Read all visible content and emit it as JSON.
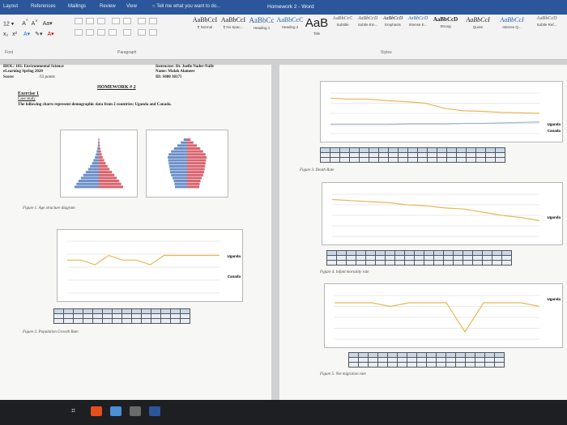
{
  "window": {
    "doc_title": "Homework 2 - Word",
    "tabs": [
      {
        "label": "Layout"
      },
      {
        "label": "References"
      },
      {
        "label": "Mailings"
      },
      {
        "label": "Review"
      },
      {
        "label": "View"
      },
      {
        "label": "Tell me what you want to do..."
      }
    ]
  },
  "ribbon": {
    "font_size": "12",
    "font_label": "Font",
    "paragraph_label": "Paragraph",
    "styles_label": "Styles",
    "styles": [
      {
        "sample": "AaBbCcI",
        "name": "¶ Normal"
      },
      {
        "sample": "AaBbCcI",
        "name": "¶ No Spac..."
      },
      {
        "sample": "AaBbCc",
        "name": "Heading 1"
      },
      {
        "sample": "AaBbCcC",
        "name": "Heading 2"
      },
      {
        "sample": "AaB",
        "name": "Title"
      },
      {
        "sample": "AaBbCcC",
        "name": "Subtitle"
      },
      {
        "sample": "AaBbCcD",
        "name": "Subtle Em..."
      },
      {
        "sample": "AaBbCcD",
        "name": "Emphasis"
      },
      {
        "sample": "AaBbCcD",
        "name": "Intense E..."
      },
      {
        "sample": "AaBbCcD",
        "name": "Strong"
      },
      {
        "sample": "AaBbCcI",
        "name": "Quote"
      },
      {
        "sample": "AaBbCcI",
        "name": "Intense Q..."
      },
      {
        "sample": "AaBbCcD",
        "name": "Subtle Ref..."
      }
    ]
  },
  "document": {
    "course": "BIOL/ 103: Environmental Science",
    "term": "eLearning Spring 2020",
    "score_label": "Score:",
    "score_value": "/15 points",
    "instructor": "Instructor: Dr. Joelle Nader-Nafir",
    "name": "Name: Malak Alameer",
    "id": "ID: S000 38175",
    "homework": "HOMEWORK # 2",
    "exercise": "Exercise 1",
    "case_study": "Case study",
    "intro": "The following charts represent demographic data from 2 countries: Uganda and Canada.",
    "figure1_caption": "Figure 1. Age structure diagram",
    "figure2_caption": "Figure 2. Population Growth Rate",
    "figure3_caption": "Figure 3. Death Rate",
    "figure4_caption": "Figure 4. Infant mortality rate",
    "figure5_caption": "Figure 5. Net migration rate",
    "legend_uganda": "Uganda",
    "legend_canada": "Canada"
  },
  "colors": {
    "word_blue": "#2b579a",
    "series_uganda": "#e8b75a",
    "series_canada": "#9cb4d6",
    "pyramid_male": "#6b8fc7",
    "pyramid_female": "#d9646e",
    "grid": "#d3d3d3"
  },
  "charts_series": {
    "growth": {
      "uganda": [
        3.2,
        3.2,
        3.1,
        3.3,
        3.2,
        3.2,
        3.1,
        3.3,
        3.3,
        3.3,
        3.3,
        3.3
      ]
    },
    "death": {
      "uganda": [
        13,
        12.8,
        12.8,
        12.5,
        12.3,
        12,
        11,
        10.5,
        10.4,
        10.2,
        10.1,
        10
      ],
      "canada": [
        7.8,
        7.8,
        7.8,
        7.8,
        7.9,
        7.9,
        7.9,
        8,
        8,
        8.1,
        8.2,
        8.3
      ]
    },
    "infant": {
      "uganda": [
        85,
        84,
        83,
        82,
        80,
        79,
        77,
        76,
        73,
        70,
        68,
        65
      ]
    },
    "migration": {
      "uganda": [
        0,
        0,
        0,
        -0.5,
        0,
        0,
        0,
        -4,
        0,
        0,
        0,
        -0.5
      ]
    }
  }
}
